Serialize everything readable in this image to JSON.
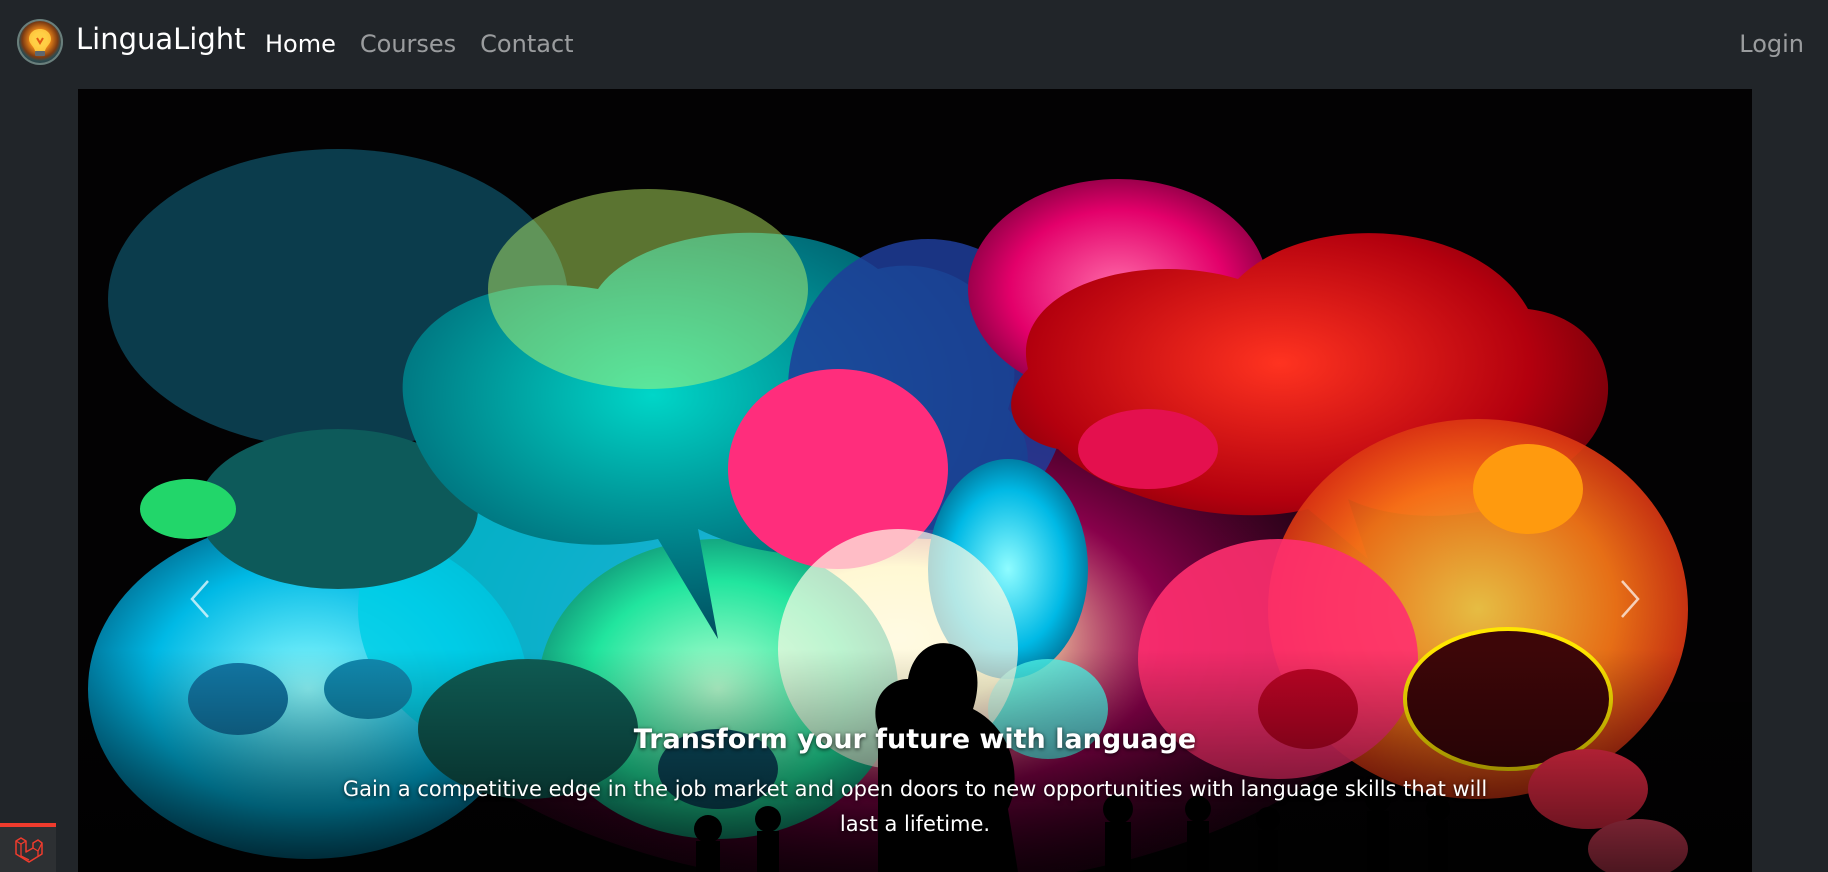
{
  "brand": {
    "name": "LinguaLight",
    "logo_icon": "lightbulb-logo-icon"
  },
  "nav": {
    "links": [
      {
        "label": "Home",
        "active": true
      },
      {
        "label": "Courses",
        "active": false
      },
      {
        "label": "Contact",
        "active": false
      }
    ],
    "login": "Login"
  },
  "hero": {
    "title": "Transform your future with language",
    "text": "Gain a competitive edge in the job market and open doors to new opportunities with language skills that will last a lifetime.",
    "prev_icon": "chevron-left-icon",
    "next_icon": "chevron-right-icon",
    "image_icon": "speech-bubbles-crowd-illustration"
  },
  "debug_badge": {
    "icon": "laravel-icon",
    "accent_color": "#ef3b2d"
  },
  "colors": {
    "background": "#212529",
    "nav_active": "#ffffff",
    "nav_inactive": "rgba(255,255,255,0.55)"
  }
}
